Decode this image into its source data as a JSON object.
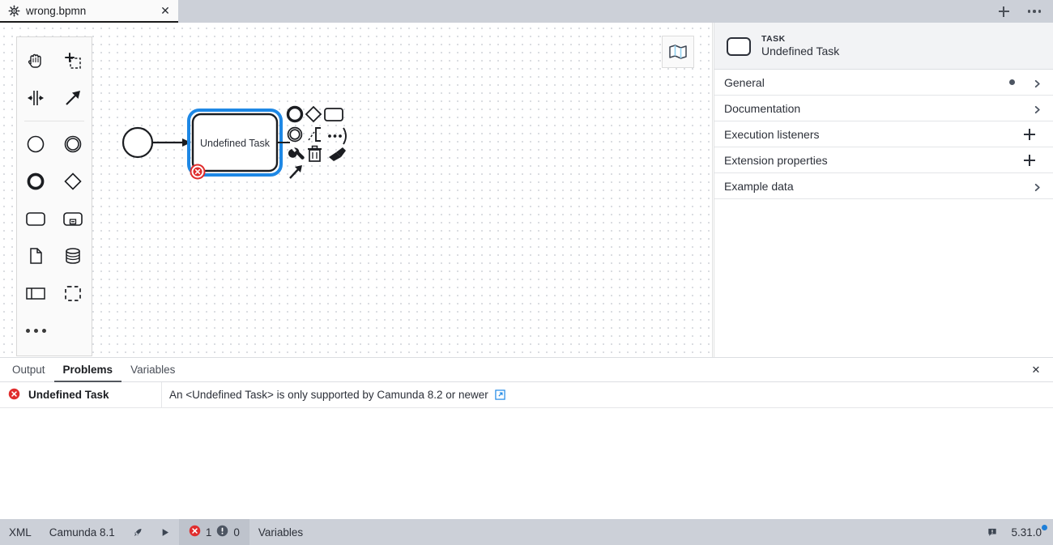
{
  "tabbar": {
    "tabs": [
      {
        "label": "wrong.bpmn",
        "icon": "gear-icon",
        "close": "✕",
        "active": true
      }
    ],
    "new_tab_label": "+",
    "more_label": "•••"
  },
  "canvas": {
    "palette": {
      "items": [
        {
          "name": "hand-tool",
          "icon": "hand-icon"
        },
        {
          "name": "lasso-tool",
          "icon": "lasso-icon"
        },
        {
          "name": "space-tool",
          "icon": "space-tool-icon"
        },
        {
          "name": "global-connect-tool",
          "icon": "arrow-connect-icon"
        },
        {
          "name": "create-start-event",
          "icon": "start-event-icon"
        },
        {
          "name": "create-intermediate-event",
          "icon": "intermediate-event-icon"
        },
        {
          "name": "create-end-event",
          "icon": "end-event-icon"
        },
        {
          "name": "create-gateway",
          "icon": "gateway-diamond-icon"
        },
        {
          "name": "create-task",
          "icon": "task-rounded-icon"
        },
        {
          "name": "create-subprocess",
          "icon": "subprocess-icon"
        },
        {
          "name": "create-data-object",
          "icon": "data-object-icon"
        },
        {
          "name": "create-data-store",
          "icon": "data-store-icon"
        },
        {
          "name": "create-participant",
          "icon": "participant-pool-icon"
        },
        {
          "name": "create-group",
          "icon": "group-dashed-icon"
        },
        {
          "name": "palette-more",
          "icon": "ellipsis-icon"
        }
      ]
    },
    "minimap": {
      "name": "minimap-toggle",
      "icon": "map-icon"
    },
    "diagram": {
      "start_event": {
        "name": "start-event"
      },
      "sequence_flow": {
        "name": "sequence-flow"
      },
      "task": {
        "label": "Undefined Task",
        "selected": true,
        "error_marker": "error-badge"
      },
      "context_pad": [
        {
          "name": "append-end-event",
          "icon": "end-event-icon"
        },
        {
          "name": "append-gateway",
          "icon": "gateway-diamond-icon"
        },
        {
          "name": "append-task",
          "icon": "task-rounded-icon"
        },
        {
          "name": "append-intermediate-event",
          "icon": "intermediate-event-icon"
        },
        {
          "name": "append-text-annotation",
          "icon": "text-annotation-icon"
        },
        {
          "name": "context-more-options",
          "icon": "ellipsis-icon"
        },
        {
          "name": "change-element-type",
          "icon": "wrench-icon"
        },
        {
          "name": "delete-element",
          "icon": "trash-icon"
        },
        {
          "name": "set-color",
          "icon": "paintbrush-icon"
        },
        {
          "name": "connect",
          "icon": "arrow-connect-icon"
        }
      ]
    }
  },
  "properties": {
    "header": {
      "type": "TASK",
      "name": "Undefined Task",
      "icon": "task-rounded-icon"
    },
    "groups": [
      {
        "label": "General",
        "has_dot": true,
        "action": "chevron"
      },
      {
        "label": "Documentation",
        "has_dot": false,
        "action": "chevron"
      },
      {
        "label": "Execution listeners",
        "has_dot": false,
        "action": "plus"
      },
      {
        "label": "Extension properties",
        "has_dot": false,
        "action": "plus"
      },
      {
        "label": "Example data",
        "has_dot": false,
        "action": "chevron"
      }
    ]
  },
  "bottom_panel": {
    "tabs": [
      {
        "label": "Output",
        "active": false
      },
      {
        "label": "Problems",
        "active": true
      },
      {
        "label": "Variables",
        "active": false
      }
    ],
    "close_label": "✕",
    "problems": [
      {
        "severity": "error",
        "name": "Undefined Task",
        "message": "An <Undefined Task> is only supported by Camunda 8.2 or newer",
        "link_icon": "external-link-icon"
      }
    ]
  },
  "status_bar": {
    "xml_label": "XML",
    "engine_label": "Camunda 8.1",
    "deploy": {
      "name": "deploy-button",
      "icon": "rocket-icon"
    },
    "run": {
      "name": "run-button",
      "icon": "play-icon"
    },
    "errors_count": "1",
    "warnings_count": "0",
    "variables_label": "Variables",
    "notifications": {
      "name": "notifications-button",
      "icon": "message-icon"
    },
    "version": "5.31.0"
  },
  "colors": {
    "accent_blue": "#1e88e5",
    "error_red": "#e02d2d",
    "chrome_gray": "#ccd0d8",
    "panel_header": "#f2f3f5"
  }
}
